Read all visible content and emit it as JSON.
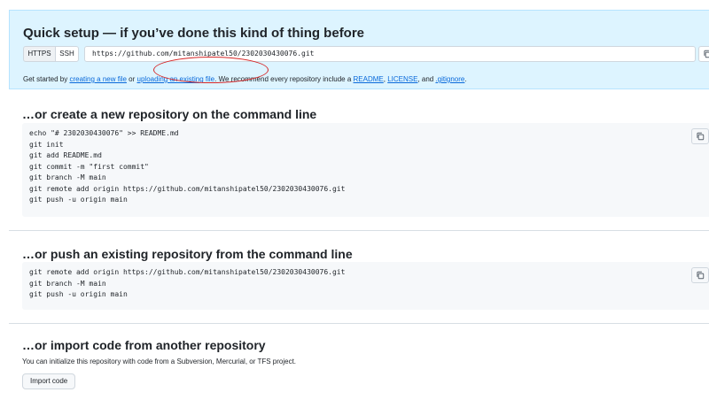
{
  "quick_setup": {
    "title": "Quick setup — if you’ve done this kind of thing before",
    "https_label": "HTTPS",
    "ssh_label": "SSH",
    "clone_url": "https://github.com/mitanshipatel50/2302030430076.git",
    "get_started_prefix": "Get started by ",
    "create_file_link": "creating a new file",
    "or_text": " or ",
    "upload_file_link": "uploading an existing file",
    "recommend_text": ". We recommend every repository include a ",
    "readme_link": "README",
    "comma": ", ",
    "license_link": "LICENSE",
    "and_text": ", and ",
    "gitignore_link": ".gitignore",
    "period": "."
  },
  "new_repo": {
    "title": "…or create a new repository on the command line",
    "commands": "echo \"# 2302030430076\" >> README.md\ngit init\ngit add README.md\ngit commit -m \"first commit\"\ngit branch -M main\ngit remote add origin https://github.com/mitanshipatel50/2302030430076.git\ngit push -u origin main"
  },
  "push_existing": {
    "title": "…or push an existing repository from the command line",
    "commands": "git remote add origin https://github.com/mitanshipatel50/2302030430076.git\ngit branch -M main\ngit push -u origin main"
  },
  "import": {
    "title": "…or import code from another repository",
    "description": "You can initialize this repository with code from a Subversion, Mercurial, or TFS project.",
    "button_label": "Import code"
  },
  "colors": {
    "accent": "#0969da",
    "quick_bg": "#ddf4ff",
    "annotation": "#d62728"
  }
}
